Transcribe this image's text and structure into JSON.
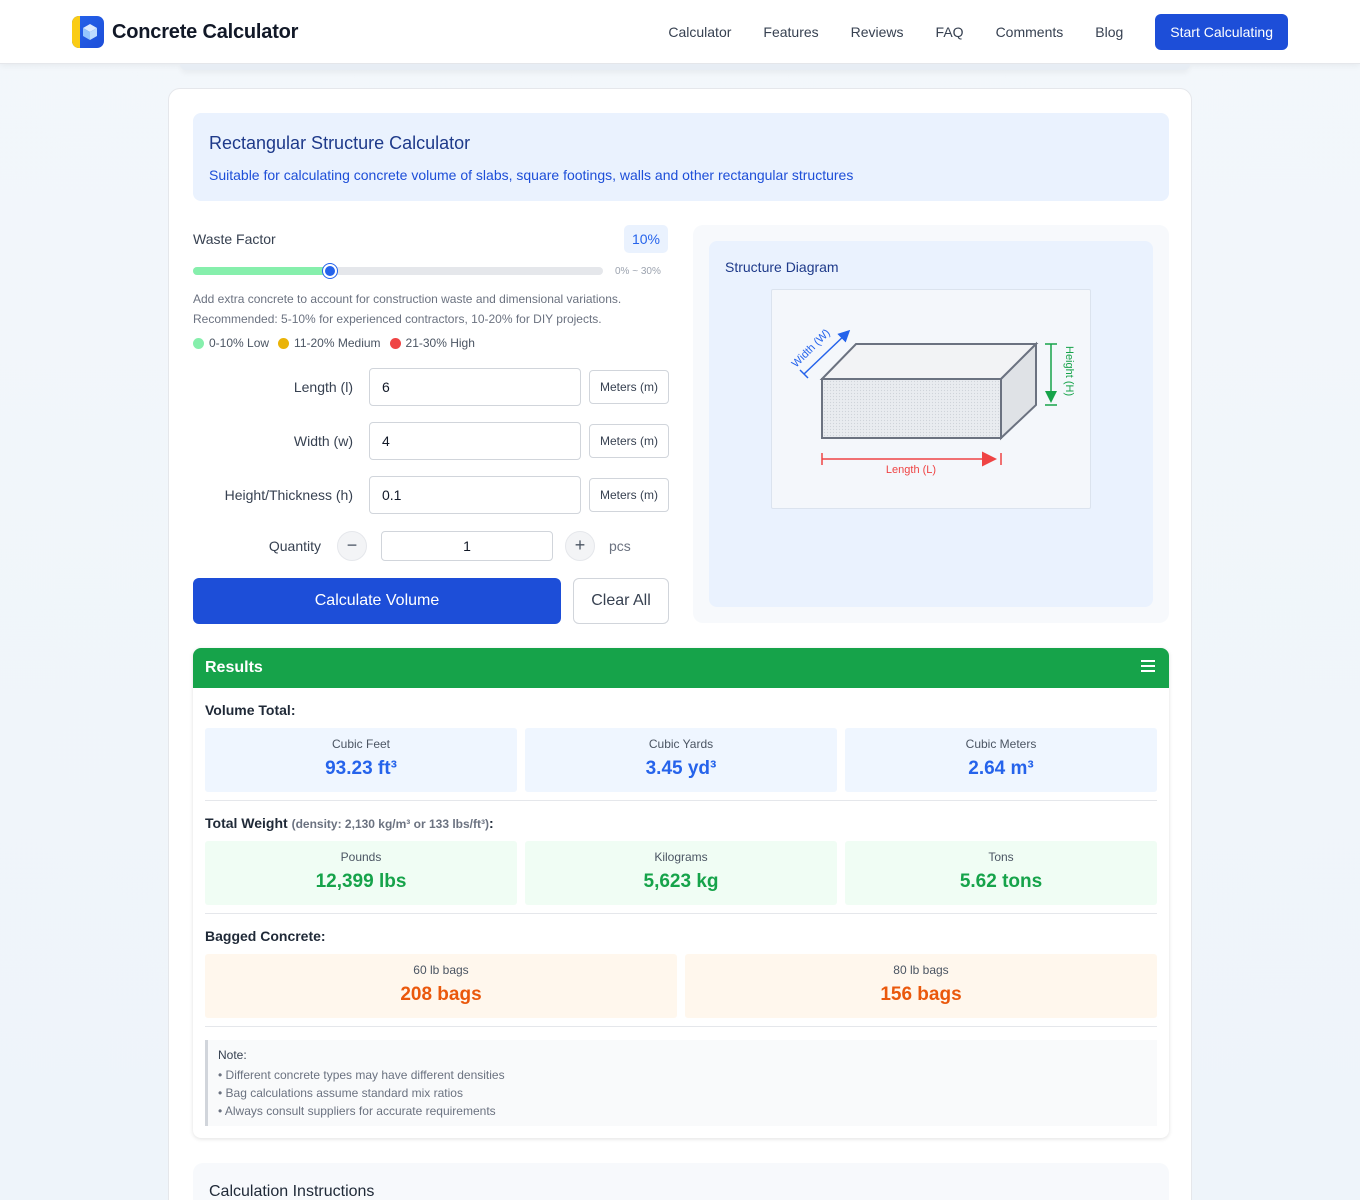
{
  "header": {
    "brand": "Concrete Calculator",
    "nav": [
      "Calculator",
      "Features",
      "Reviews",
      "FAQ",
      "Comments",
      "Blog"
    ],
    "cta": "Start Calculating"
  },
  "intro": {
    "title": "Rectangular Structure Calculator",
    "subtitle": "Suitable for calculating concrete volume of slabs, square footings, walls and other rectangular structures"
  },
  "waste": {
    "label": "Waste Factor",
    "value": "10%",
    "fraction": 0.3333,
    "range_hint": "0% ~ 30%",
    "desc1": "Add extra concrete to account for construction waste and dimensional variations.",
    "desc2": "Recommended: 5-10% for experienced contractors, 10-20% for DIY projects.",
    "legend": [
      {
        "label": "0-10% Low",
        "color": "#86efac"
      },
      {
        "label": "11-20% Medium",
        "color": "#eab308"
      },
      {
        "label": "21-30% High",
        "color": "#ef4444"
      }
    ]
  },
  "fields": {
    "length": {
      "label": "Length (l)",
      "value": "6",
      "unit": "Meters (m)"
    },
    "width": {
      "label": "Width (w)",
      "value": "4",
      "unit": "Meters (m)"
    },
    "height": {
      "label": "Height/Thickness (h)",
      "value": "0.1",
      "unit": "Meters (m)"
    }
  },
  "quantity": {
    "label": "Quantity",
    "value": "1",
    "unit": "pcs",
    "minus": "−",
    "plus": "+"
  },
  "buttons": {
    "calculate": "Calculate Volume",
    "clear": "Clear All"
  },
  "diagram": {
    "title": "Structure Diagram",
    "width_label": "Width (W)",
    "height_label": "Height (H)",
    "length_label": "Length (L)",
    "colors": {
      "width": "#2563eb",
      "height": "#16a34a",
      "length": "#ef4444"
    }
  },
  "results": {
    "title": "Results",
    "volume": {
      "title": "Volume Total:",
      "items": [
        {
          "label": "Cubic Feet",
          "value": "93.23 ft³"
        },
        {
          "label": "Cubic Yards",
          "value": "3.45 yd³"
        },
        {
          "label": "Cubic Meters",
          "value": "2.64 m³"
        }
      ]
    },
    "weight": {
      "title": "Total Weight",
      "density": "(density: 2,130 kg/m³ or 133 lbs/ft³)",
      "suffix": ":",
      "items": [
        {
          "label": "Pounds",
          "value": "12,399 lbs"
        },
        {
          "label": "Kilograms",
          "value": "5,623 kg"
        },
        {
          "label": "Tons",
          "value": "5.62 tons"
        }
      ]
    },
    "bags": {
      "title": "Bagged Concrete:",
      "items": [
        {
          "label": "60 lb bags",
          "value": "208 bags"
        },
        {
          "label": "80 lb bags",
          "value": "156 bags"
        }
      ]
    },
    "note": {
      "title": "Note:",
      "items": [
        "• Different concrete types may have different densities",
        "• Bag calculations assume standard mix ratios",
        "• Always consult suppliers for accurate requirements"
      ]
    }
  },
  "instructions": {
    "title": "Calculation Instructions"
  }
}
